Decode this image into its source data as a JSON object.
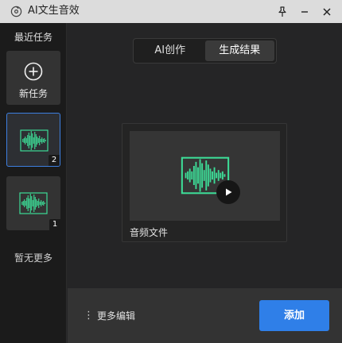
{
  "window": {
    "title": "AI文生音效",
    "icons": {
      "app": "music-note-icon",
      "pin": "pin-icon",
      "minimize": "minimize-icon",
      "close": "close-icon"
    }
  },
  "sidebar": {
    "title": "最近任务",
    "new_task_label": "新任务",
    "tasks": [
      {
        "badge": "2",
        "icon": "waveform-icon",
        "selected": true
      },
      {
        "badge": "1",
        "icon": "waveform-icon",
        "selected": false
      }
    ],
    "no_more": "暂无更多"
  },
  "main": {
    "tabs": [
      {
        "label": "AI创作",
        "selected": false
      },
      {
        "label": "生成结果",
        "selected": true
      }
    ],
    "result": {
      "label": "音频文件",
      "icon": "waveform-icon",
      "play_icon": "play-icon"
    }
  },
  "footer": {
    "more_edit_label": "更多编辑",
    "add_label": "添加"
  },
  "colors": {
    "accent": "#2f7fe8",
    "waveform": "#3ddc97"
  }
}
